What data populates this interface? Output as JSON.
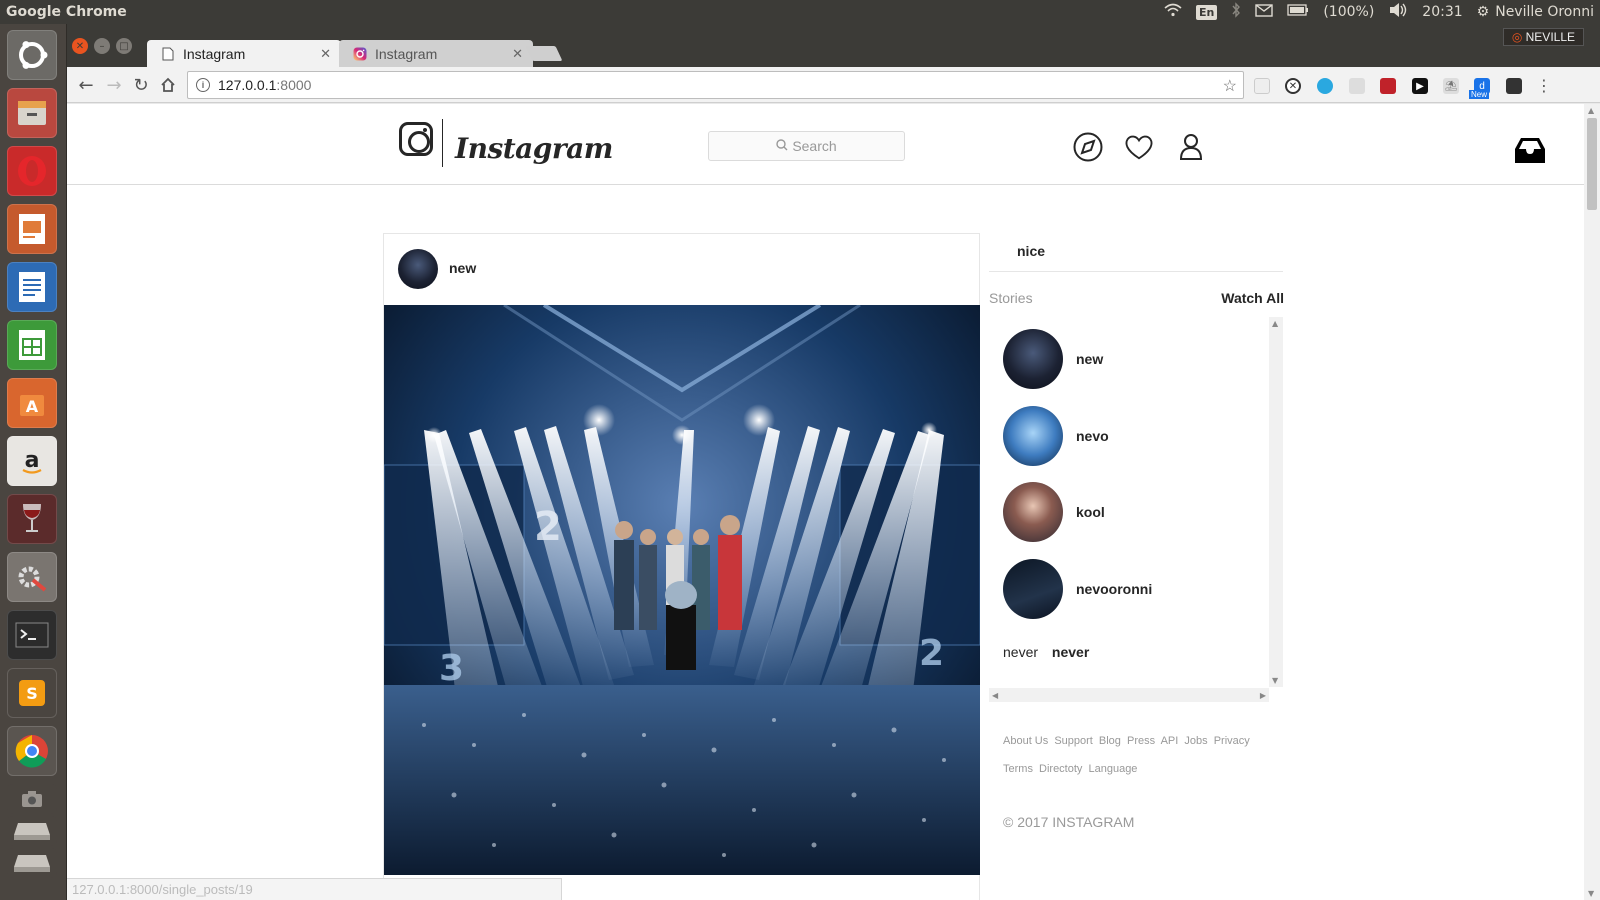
{
  "os": {
    "app_title": "Google Chrome",
    "keyboard_layout": "En",
    "battery": "(100%)",
    "clock": "20:31",
    "user": "Neville Oronni"
  },
  "launcher": {
    "items": [
      "ubuntu-dash",
      "files",
      "opera",
      "impress",
      "writer",
      "calc",
      "software-center",
      "amazon",
      "wine",
      "system-settings",
      "terminal",
      "sublime-text",
      "chrome",
      "camera",
      "drive",
      "drive"
    ]
  },
  "browser": {
    "profile": "NEVILLE",
    "tabs": [
      {
        "label": "Instagram",
        "active": true
      },
      {
        "label": "Instagram",
        "active": false
      }
    ],
    "url_host": "127.0.0.1",
    "url_port": ":8000",
    "extension_badge": "New",
    "status_url": "127.0.0.1:8000/single_posts/19"
  },
  "header": {
    "wordmark": "Instagram",
    "search_placeholder": "Search"
  },
  "post": {
    "username": "new"
  },
  "sidebar": {
    "username": "nice",
    "stories_label": "Stories",
    "watch_all": "Watch All",
    "stories": [
      {
        "name": "new"
      },
      {
        "name": "nevo"
      },
      {
        "name": "kool"
      },
      {
        "name": "nevooronni"
      }
    ],
    "never_caption": "never",
    "never_user": "never",
    "footer_links": [
      "About Us",
      "Support",
      "Blog",
      "Press",
      "API",
      "Jobs",
      "Privacy",
      "Terms",
      "Directoty",
      "Language"
    ],
    "copyright": "© 2017 INSTAGRAM"
  },
  "colors": {
    "ubuntu_panel": "#3c3b37",
    "ig_text": "#262626",
    "ig_muted": "#999999",
    "border": "#dbdbdb"
  }
}
